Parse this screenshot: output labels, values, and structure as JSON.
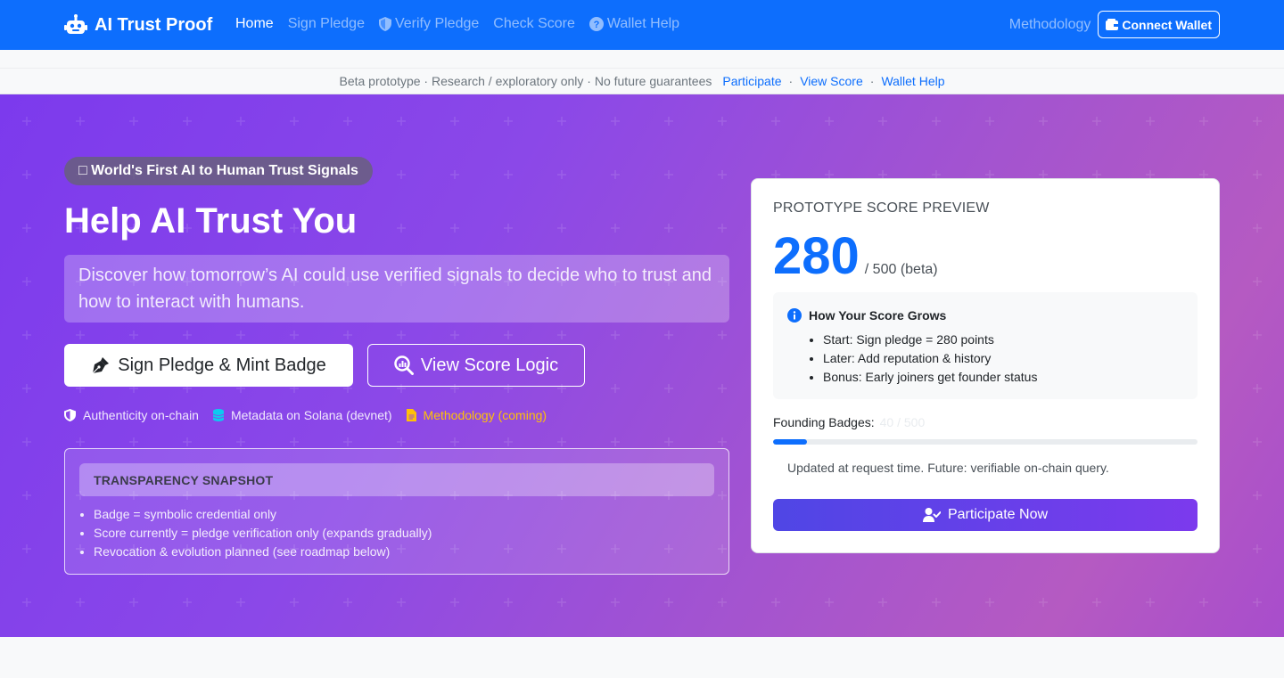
{
  "navbar": {
    "brand": "AI Trust Proof",
    "links": [
      {
        "label": "Home",
        "active": true
      },
      {
        "label": "Sign Pledge"
      },
      {
        "label": "Verify Pledge",
        "icon": "shield-icon"
      },
      {
        "label": "Check Score"
      },
      {
        "label": "Wallet Help",
        "icon": "question-circle-icon"
      }
    ],
    "methodology": "Methodology",
    "connect_wallet": "Connect Wallet"
  },
  "beta_bar": {
    "notice": "Beta prototype · Research / exploratory only · No future guarantees",
    "links": [
      "Participate",
      "View Score",
      "Wallet Help"
    ],
    "separator": "·"
  },
  "hero": {
    "pill": "□ World's First AI to Human Trust Signals",
    "title": "Help AI Trust You",
    "lead": "Discover how tomorrow’s AI could use verified signals to decide who to trust and how to interact with humans.",
    "primary_button": "Sign Pledge & Mint Badge",
    "secondary_button": "View Score Logic",
    "features": [
      {
        "label": "Authenticity on-chain",
        "icon": "shield-half-icon"
      },
      {
        "label": "Metadata on Solana (devnet)",
        "icon": "database-icon"
      },
      {
        "label": "Methodology (coming)",
        "icon": "file-text-icon"
      }
    ],
    "snapshot": {
      "title": "TRANSPARENCY SNAPSHOT",
      "items": [
        "Badge = symbolic credential only",
        "Score currently = pledge verification only (expands gradually)",
        "Revocation & evolution planned (see roadmap below)"
      ]
    }
  },
  "score_card": {
    "kicker": "PROTOTYPE SCORE PREVIEW",
    "score": "280",
    "score_suffix": "/ 500 (beta)",
    "grow_title": "How Your Score Grows",
    "grow_items": [
      "Start: Sign pledge = 280 points",
      "Later: Add reputation & history",
      "Bonus: Early joiners get founder status"
    ],
    "founding_label": "Founding Badges:",
    "founding_count": "40 / 500",
    "progress_fraction": 0.08,
    "updated_note": "Updated at request time. Future: verifiable on-chain query.",
    "participate_button": "Participate Now"
  },
  "colors": {
    "primary": "#0d6efd",
    "hero_start": "#7c3aed",
    "hero_end": "#b55ac2",
    "warning": "#ffc107"
  }
}
